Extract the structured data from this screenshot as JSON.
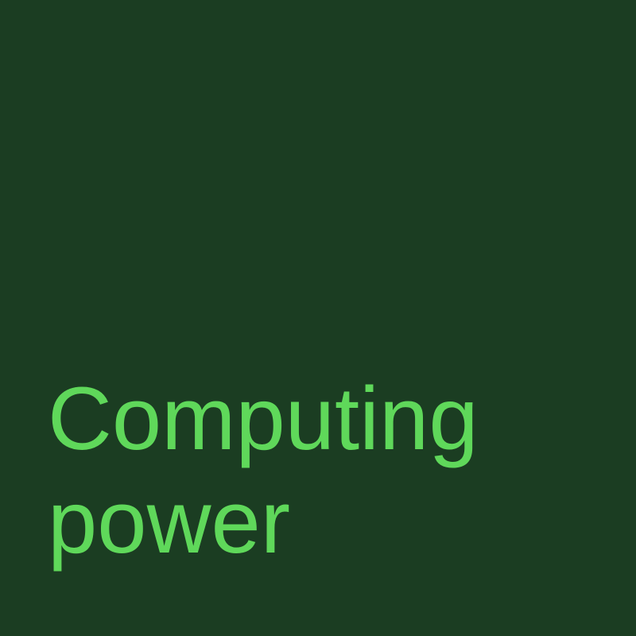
{
  "tile": {
    "title_lines": [
      "Computing",
      "power"
    ],
    "background_color": "#1b3d22",
    "text_color": "#5fd85a"
  }
}
